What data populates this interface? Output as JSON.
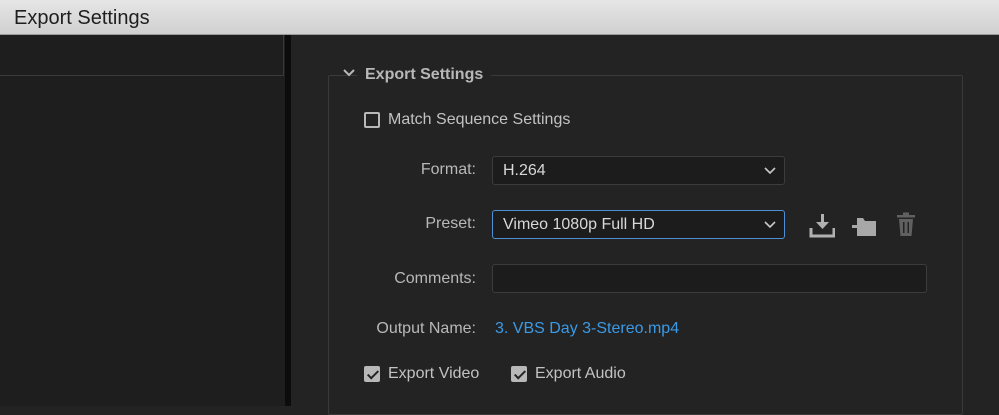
{
  "window": {
    "title": "Export Settings"
  },
  "section": {
    "title": "Export Settings"
  },
  "match_sequence": {
    "label": "Match Sequence Settings",
    "checked": false
  },
  "format": {
    "label": "Format:",
    "value": "H.264"
  },
  "preset": {
    "label": "Preset:",
    "value": "Vimeo 1080p Full HD",
    "actions": [
      "save-preset-icon",
      "import-preset-icon",
      "delete-preset-icon"
    ]
  },
  "comments": {
    "label": "Comments:",
    "value": ""
  },
  "output": {
    "label": "Output Name:",
    "value": "3. VBS Day 3-Stereo.mp4"
  },
  "export_video": {
    "label": "Export Video",
    "checked": true
  },
  "export_audio": {
    "label": "Export Audio",
    "checked": true
  },
  "colors": {
    "accent": "#3b9ae6",
    "focus_border": "#4f8fd6"
  }
}
